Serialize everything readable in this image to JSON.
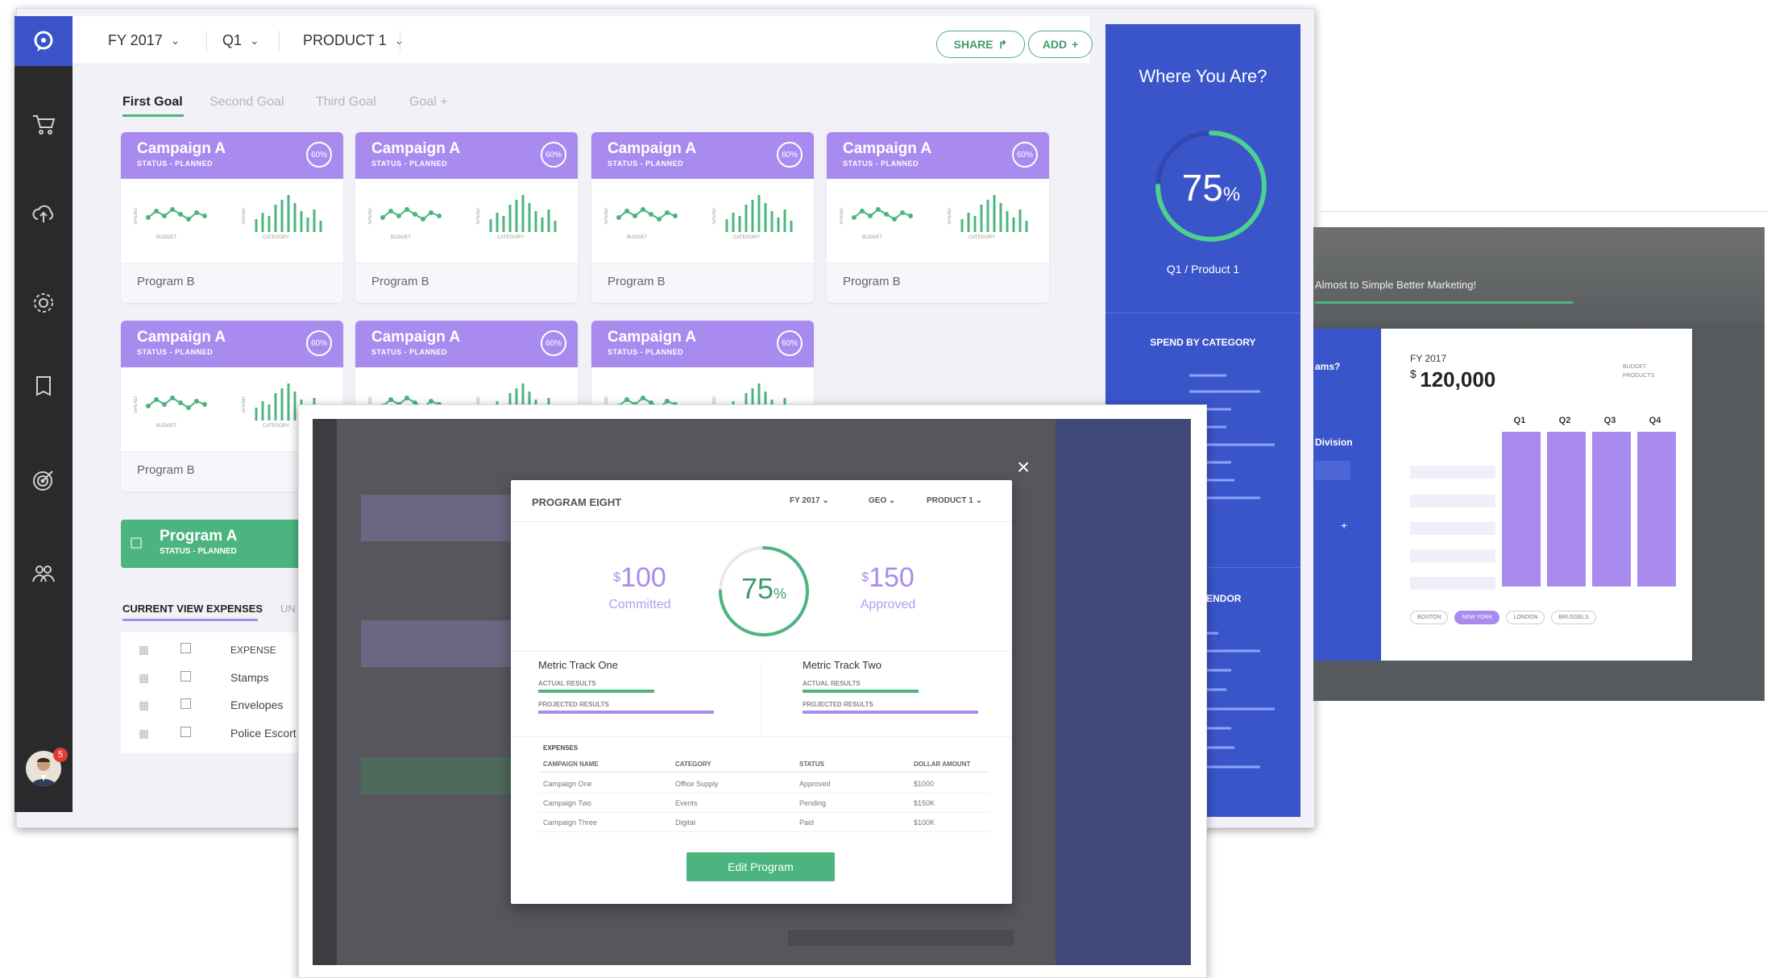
{
  "main": {
    "filters": {
      "year": "FY 2017",
      "quarter": "Q1",
      "product": "PRODUCT 1"
    },
    "actions": {
      "share": "SHARE",
      "add": "ADD"
    },
    "goal_tabs": [
      "First Goal",
      "Second Goal",
      "Third Goal",
      "Goal +"
    ],
    "card": {
      "title": "Campaign A",
      "status": "STATUS - PLANNED",
      "badge": "60%",
      "footer": "Program B",
      "chart1_axis": "SPEND",
      "chart1_label": "BUDGET",
      "chart2_axis": "SPEND",
      "chart2_label": "CATEGORY"
    },
    "program_bar": {
      "title": "Program A",
      "status": "STATUS - PLANNED"
    },
    "expense_tabs": {
      "current": "CURRENT VIEW EXPENSES",
      "other": "UN"
    },
    "expense_rows": [
      "EXPENSE",
      "Stamps",
      "Envelopes",
      "Police Escort"
    ],
    "notification_count": "5"
  },
  "blue_panel": {
    "title": "Where You Are?",
    "percent": "75",
    "percent_sign": "%",
    "progress_fraction": 0.75,
    "subtitle": "Q1 / Product 1",
    "spend_title": "SPEND BY CATEGORY",
    "vendor_title": "Y VENDOR"
  },
  "right_screen": {
    "banner": "Almost to Simple Better Marketing!",
    "side_title": "ams?",
    "side_division": "Division",
    "fy": "FY 2017",
    "amount": "120,000",
    "currency": "$",
    "legend": [
      "BUDGET",
      "PRODUCTS"
    ],
    "quarters": [
      "Q1",
      "Q2",
      "Q3",
      "Q4"
    ],
    "pills": [
      "BOSTON",
      "NEW YORK",
      "LONDON",
      "BRUSSELS"
    ]
  },
  "modal": {
    "title": "PROGRAM EIGHT",
    "filters": {
      "year": "FY 2017",
      "geo": "GEO",
      "product": "PRODUCT 1"
    },
    "committed_value": "100",
    "committed_label": "Committed",
    "approved_value": "150",
    "approved_label": "Approved",
    "currency": "$",
    "percent": "75",
    "percent_sign": "%",
    "progress_fraction": 0.75,
    "metric_one": "Metric Track One",
    "metric_two": "Metric Track Two",
    "actual_label": "ACTUAL RESULTS",
    "projected_label": "PROJECTED RESULTS",
    "expenses_label": "EXPENSES",
    "columns": [
      "CAMPAIGN NAME",
      "CATEGORY",
      "STATUS",
      "DOLLAR AMOUNT"
    ],
    "rows": [
      [
        "Campaign One",
        "Office Supply",
        "Approved",
        "$1000"
      ],
      [
        "Campaign Two",
        "Events",
        "Pending",
        "$150K"
      ],
      [
        "Campaign Three",
        "Digital",
        "Paid",
        "$100K"
      ]
    ],
    "edit_button": "Edit Program"
  },
  "colors": {
    "brand_blue": "#3a55c9",
    "purple": "#a98bf0",
    "green": "#4cb57f",
    "dark": "#2a2a2c"
  }
}
